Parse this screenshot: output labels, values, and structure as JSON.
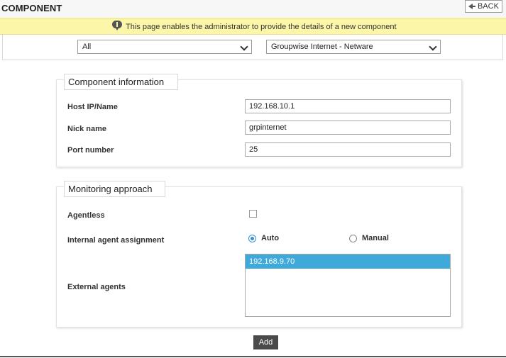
{
  "header": {
    "title": "COMPONENT",
    "back_label": "BACK"
  },
  "banner": {
    "message": "This page enables the administrator to provide the details of a new component"
  },
  "filters": {
    "category_selected": "All",
    "component_type_selected": "Groupwise Internet - Netware"
  },
  "component_info": {
    "legend": "Component information",
    "host_label": "Host IP/Name",
    "host_value": "192.168.10.1",
    "nick_label": "Nick name",
    "nick_value": "grpinternet",
    "port_label": "Port number",
    "port_value": "25"
  },
  "monitoring": {
    "legend": "Monitoring approach",
    "agentless_label": "Agentless",
    "agentless_checked": false,
    "internal_label": "Internal agent assignment",
    "option_auto": "Auto",
    "option_manual": "Manual",
    "selected_option": "Auto",
    "external_label": "External agents",
    "external_agents": [
      "192.168.9.70"
    ]
  },
  "actions": {
    "add_label": "Add"
  },
  "colors": {
    "banner_bg": "#fcf6a9",
    "selected_item": "#3fa9d9",
    "add_button": "#4a4a4a"
  }
}
